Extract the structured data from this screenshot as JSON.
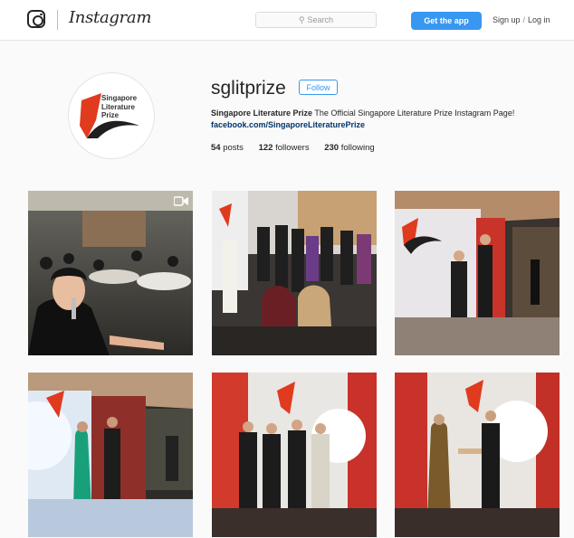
{
  "topbar": {
    "logo_icon": "instagram-camera-icon",
    "wordmark": "Instagram",
    "search_placeholder": "Search",
    "search_icon": "search-icon",
    "get_app_label": "Get the app",
    "signup_label": "Sign up",
    "separator": "/",
    "login_label": "Log in"
  },
  "profile": {
    "avatar_text": [
      "Singapore",
      "Literature",
      "Prize"
    ],
    "username": "sglitprize",
    "follow_label": "Follow",
    "bio_name": "Singapore Literature Prize",
    "bio_text": "The Official Singapore Literature Prize Instagram Page!",
    "bio_link": "facebook.com/SingaporeLiteraturePrize",
    "stats": {
      "posts_count": "54",
      "posts_label": "posts",
      "followers_count": "122",
      "followers_label": "followers",
      "following_count": "230",
      "following_label": "following"
    }
  },
  "colors": {
    "accent_blue": "#3897f0",
    "link_blue": "#003569",
    "brand_red": "#e03a1f",
    "brand_dark": "#1f1f1f"
  },
  "posts": [
    {
      "scene": "banquet-hall-woman-with-microphone",
      "video": true
    },
    {
      "scene": "group-photo-on-stage",
      "video": false
    },
    {
      "scene": "award-presentation-at-podium",
      "video": false
    },
    {
      "scene": "presenters-on-stage-with-backdrop",
      "video": false
    },
    {
      "scene": "four-men-in-suits-on-stage",
      "video": false
    },
    {
      "scene": "award-handover-on-stage",
      "video": false
    }
  ]
}
